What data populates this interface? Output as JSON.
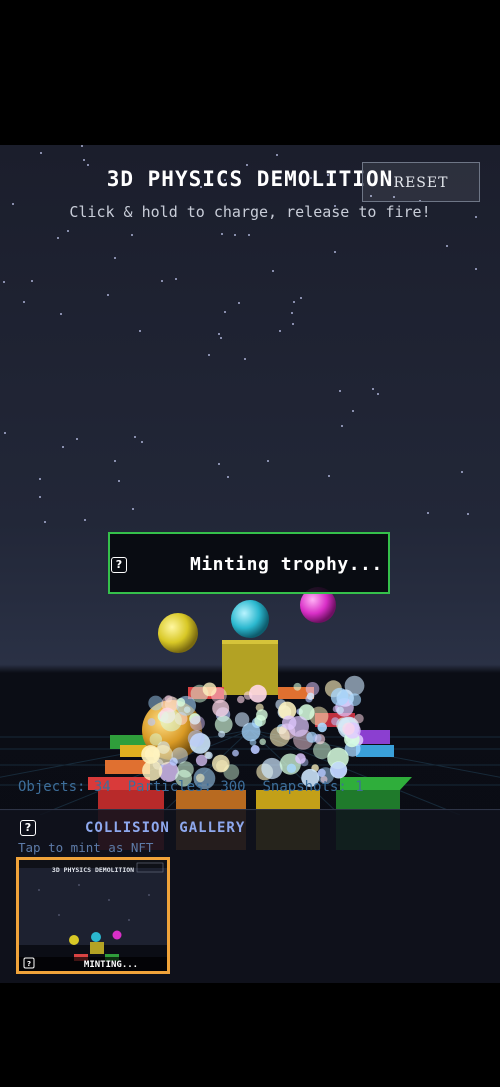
{
  "header": {
    "title": "3D PHYSICS DEMOLITION",
    "subtitle": "Click & hold to charge, release to fire!",
    "reset_label": "RESET"
  },
  "status_banner": {
    "text": "Minting trophy...",
    "icon": "question-icon",
    "border_color": "#35c04b"
  },
  "stats": {
    "objects_label": "Objects:",
    "objects": "34",
    "particles_label": "Particles:",
    "particles": "300",
    "snapshots_label": "Snapshots:",
    "snapshots": "1"
  },
  "gallery": {
    "title": "COLLISION GALLERY",
    "subtitle": "Tap to mint as NFT",
    "items": [
      {
        "title": "3D PHYSICS DEMOLITION",
        "status": "MINTING...",
        "border_color": "#f0a33a"
      }
    ]
  },
  "scene": {
    "spheres": [
      {
        "color": "#d8c826"
      },
      {
        "color": "#2bb8cf"
      },
      {
        "color": "#d92fc7"
      },
      {
        "color": "#d99a25"
      }
    ],
    "block_colors": [
      "#d93a3a",
      "#2f9e3b",
      "#e0b020",
      "#3aa0d9",
      "#8b3fd0",
      "#e07030"
    ]
  }
}
